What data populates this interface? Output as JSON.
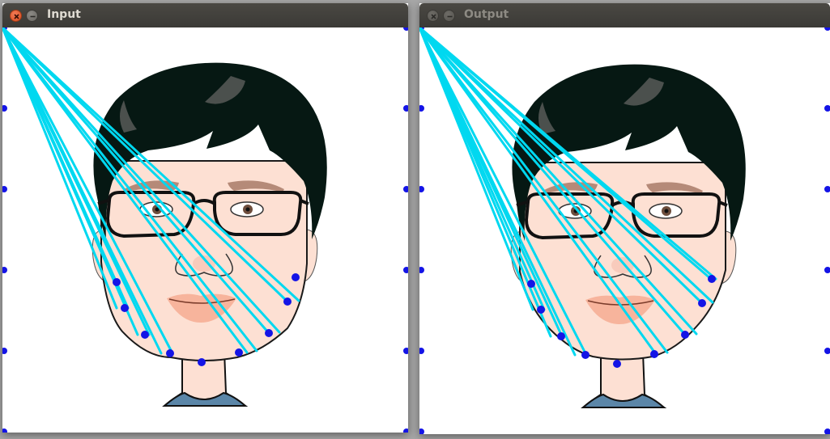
{
  "windows": [
    {
      "id": "input",
      "title": "Input",
      "active": true
    },
    {
      "id": "output",
      "title": "Output",
      "active": false
    }
  ],
  "colors": {
    "landmark_point": "#1414e6",
    "displacement_line": "#00d8f0",
    "skin": "#fde0d3",
    "hair": "#061813",
    "lips": "#f7b49c",
    "shirt": "#5b86a8",
    "titlebar": "#3d3c38"
  },
  "icons": [
    "close-icon",
    "minimize-icon"
  ]
}
